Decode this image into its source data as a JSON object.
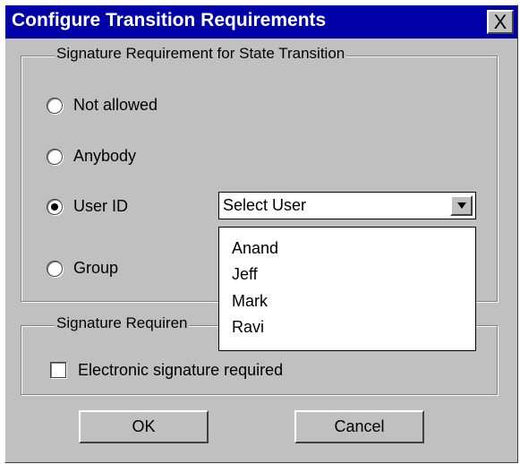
{
  "dialog": {
    "title": "Configure Transition Requirements",
    "close_glyph": "X"
  },
  "signature_group": {
    "label": "Signature Requirement for State Transition",
    "options": [
      {
        "label": "Not allowed",
        "selected": false
      },
      {
        "label": "Anybody",
        "selected": false
      },
      {
        "label": "User ID",
        "selected": true
      },
      {
        "label": "Group",
        "selected": false
      }
    ]
  },
  "user_select": {
    "value": "Select User",
    "options": [
      "Anand",
      "Jeff",
      "Mark",
      "Ravi"
    ]
  },
  "second_group": {
    "label": "Signature Requiren",
    "checkbox_label": "Electronic signature required",
    "checkbox_checked": false
  },
  "buttons": {
    "ok": "OK",
    "cancel": "Cancel"
  },
  "colors": {
    "titlebar": "#0000a8",
    "face": "#c0c0c0"
  }
}
